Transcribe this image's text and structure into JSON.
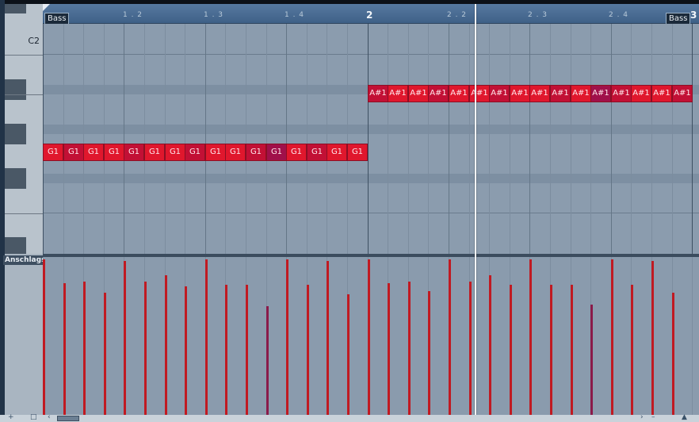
{
  "keyboard": {
    "label_c2": "C2"
  },
  "ruler": {
    "marks": [
      "1 . 2",
      "1 . 3",
      "1 . 4",
      "2",
      "2 . 2",
      "2 . 3",
      "2 . 4",
      "3"
    ],
    "part_label_left": "Bass",
    "part_label_right": "Bass"
  },
  "notes": {
    "low_pitch": "G1",
    "high_pitch": "A#1",
    "low_count": 16,
    "high_count": 16
  },
  "velocity_lane": {
    "title": "Anschlags"
  },
  "velocities": [
    100,
    85,
    86,
    79,
    99,
    86,
    90,
    83,
    100,
    84,
    84,
    70,
    100,
    84,
    99,
    78,
    100,
    85,
    86,
    80,
    100,
    86,
    90,
    84,
    100,
    84,
    84,
    71,
    100,
    84,
    99,
    79
  ],
  "colors": {
    "note_red": "#e0172d",
    "note_magenta": "#a0104a",
    "velocity_red": "#c01a22",
    "velocity_magenta": "#8a1b4a"
  },
  "icons": [
    "plus-icon",
    "page-icon",
    "scroll-left-icon",
    "scroll-right-icon",
    "zoom-minus-icon",
    "zoom-slider-icon"
  ]
}
